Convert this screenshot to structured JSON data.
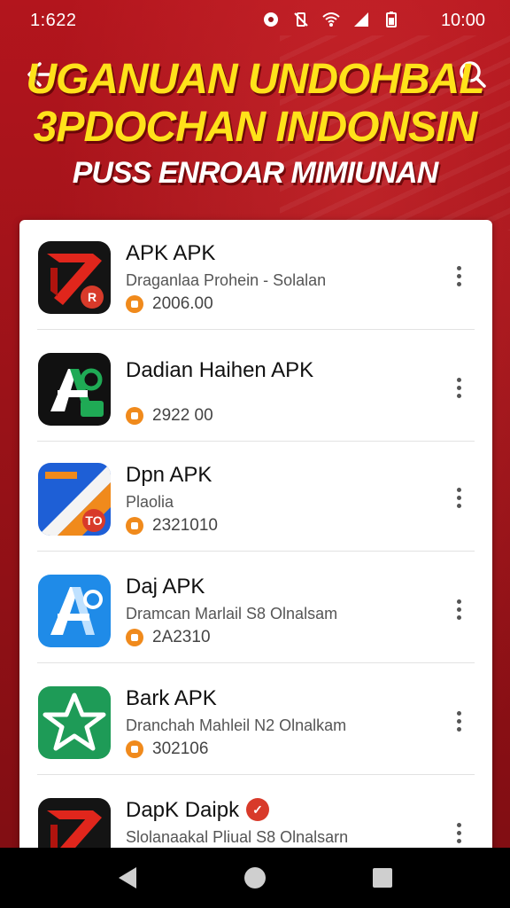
{
  "status_bar": {
    "time_left": "1:622",
    "time_right": "10:00",
    "icons": [
      "record-icon",
      "vibrate-off-icon",
      "wifi-icon",
      "signal-icon",
      "battery-icon"
    ]
  },
  "header": {
    "line1": "UGANUAN UNDOHBAL",
    "line2": "3PDOCHAN INDONSIN",
    "line3": "PUSS ENROAR MIMIUNAN",
    "back_icon": "arrow-left-icon",
    "search_icon": "search-icon"
  },
  "apps": [
    {
      "title": "APK APK",
      "subtitle": "Draganlaa Prohein  - Solalan",
      "meta": "2006.00",
      "icon": "red-black-arrow-app-icon",
      "icon_badge": "R"
    },
    {
      "title": "Dadian Haihen APK",
      "subtitle": "",
      "meta": "2922 00",
      "icon": "black-green-a-app-icon",
      "icon_badge": ""
    },
    {
      "title": "Dpn APK",
      "subtitle": "Plaolia",
      "meta": "2321010",
      "icon": "blue-orange-app-icon",
      "icon_badge": "TO"
    },
    {
      "title": "Daj APK",
      "subtitle": "Dramcan Marlail S8 Olnalsam",
      "meta": "2A2310",
      "icon": "blue-a-app-icon",
      "icon_badge": ""
    },
    {
      "title": "Bark APK",
      "subtitle": "Dranchah Mahleil N2 Olnalkam",
      "meta": "302106",
      "icon": "green-star-app-icon",
      "icon_badge": ""
    },
    {
      "title": "DapK Daipk",
      "subtitle": "Slolanaakal Pliual S8 Olnalsarn",
      "meta": "",
      "icon": "red-black-arrow-app-icon",
      "icon_badge": ""
    }
  ],
  "colors": {
    "background": "#9a1218",
    "headline": "#ffe21a",
    "card": "#ffffff",
    "meta_dot": "#f08a1c"
  },
  "nav_bar": {
    "icons": [
      "nav-back-icon",
      "nav-home-icon",
      "nav-recent-icon"
    ]
  }
}
